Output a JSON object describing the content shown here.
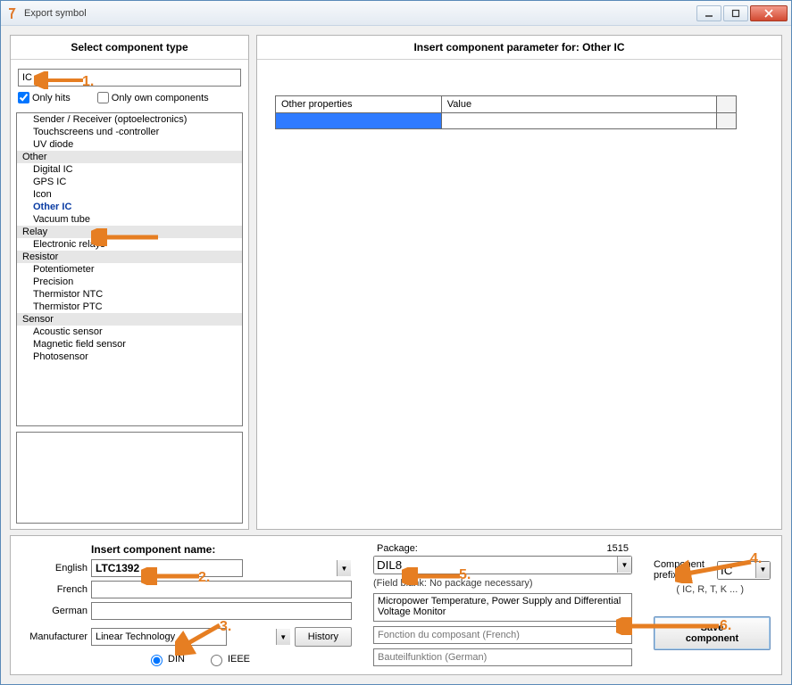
{
  "window": {
    "title": "Export symbol"
  },
  "left_panel": {
    "title": "Select component type",
    "search_value": "IC",
    "only_hits_label": "Only hits",
    "only_own_label": "Only own components",
    "only_hits_checked": true,
    "only_own_checked": false,
    "tree": [
      {
        "label": "Sender / Receiver (optoelectronics)",
        "type": "child"
      },
      {
        "label": "Touchscreens und -controller",
        "type": "child"
      },
      {
        "label": "UV diode",
        "type": "child"
      },
      {
        "label": "Other",
        "type": "cat"
      },
      {
        "label": "Digital IC",
        "type": "child"
      },
      {
        "label": "GPS IC",
        "type": "child"
      },
      {
        "label": "Icon",
        "type": "child"
      },
      {
        "label": "Other IC",
        "type": "child",
        "selected": true
      },
      {
        "label": "Vacuum tube",
        "type": "child"
      },
      {
        "label": "Relay",
        "type": "cat"
      },
      {
        "label": "Electronic relays",
        "type": "child"
      },
      {
        "label": "Resistor",
        "type": "cat"
      },
      {
        "label": "Potentiometer",
        "type": "child"
      },
      {
        "label": "Precision",
        "type": "child"
      },
      {
        "label": "Thermistor NTC",
        "type": "child"
      },
      {
        "label": "Thermistor PTC",
        "type": "child"
      },
      {
        "label": "Sensor",
        "type": "cat"
      },
      {
        "label": "Acoustic sensor",
        "type": "child"
      },
      {
        "label": "Magnetic field sensor",
        "type": "child"
      },
      {
        "label": "Photosensor",
        "type": "child"
      }
    ]
  },
  "right_panel": {
    "title": "Insert component parameter for: Other IC",
    "col_other": "Other properties",
    "col_value": "Value"
  },
  "lower": {
    "name_title": "Insert component name:",
    "english_label": "English",
    "english_value": "LTC1392",
    "french_label": "French",
    "french_value": "",
    "german_label": "German",
    "german_value": "",
    "manufacturer_label": "Manufacturer",
    "manufacturer_value": "Linear Technology",
    "history_label": "History",
    "din_label": "DIN",
    "ieee_label": "IEEE",
    "package_label": "Package:",
    "package_code": "1515",
    "package_value": "DIL8",
    "package_hint": "(Field blank: No package necessary)",
    "desc_en": "Micropower Temperature, Power Supply and Differential Voltage Monitor",
    "desc_fr_placeholder": "Fonction du composant (French)",
    "desc_de_placeholder": "Bauteilfunktion (German)",
    "prefix_label": "Component prefix:",
    "prefix_value": "IC",
    "prefix_hint": "( IC, R, T, K ... )",
    "save_label": "Save component"
  },
  "annotations": {
    "n1": "1.",
    "n2": "2.",
    "n3": "3.",
    "n4": "4.",
    "n5": "5.",
    "n6": "6."
  }
}
